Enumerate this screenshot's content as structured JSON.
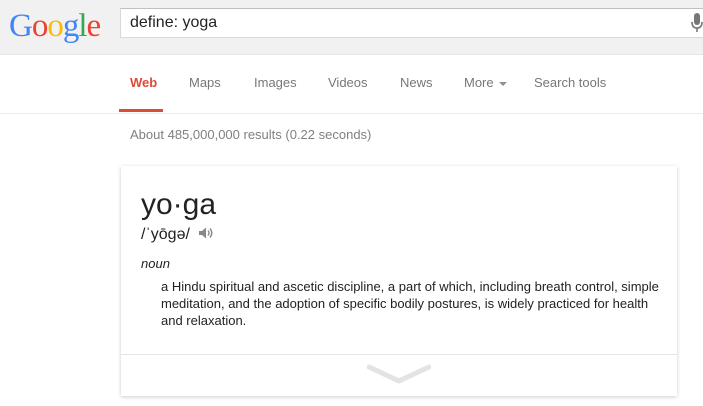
{
  "header": {
    "logo_letters": [
      {
        "ch": "G",
        "color": "#4285f4"
      },
      {
        "ch": "o",
        "color": "#ea4335"
      },
      {
        "ch": "o",
        "color": "#fbbc05"
      },
      {
        "ch": "g",
        "color": "#4285f4"
      },
      {
        "ch": "l",
        "color": "#34a853"
      },
      {
        "ch": "e",
        "color": "#ea4335"
      }
    ],
    "search_value": "define: yoga",
    "mic_icon": "microphone-icon"
  },
  "nav": {
    "tabs": [
      {
        "label": "Web",
        "active": true
      },
      {
        "label": "Maps",
        "active": false
      },
      {
        "label": "Images",
        "active": false
      },
      {
        "label": "Videos",
        "active": false
      },
      {
        "label": "News",
        "active": false
      },
      {
        "label": "More",
        "active": false
      },
      {
        "label": "Search tools",
        "active": false
      }
    ],
    "active_color": "#dd4b39"
  },
  "results": {
    "stats": "About 485,000,000 results (0.22 seconds)"
  },
  "definition_card": {
    "word": "yo·ga",
    "pronunciation": "/ˈyōgə/",
    "speaker_icon": "speaker-icon",
    "part_of_speech": "noun",
    "definition": "a Hindu spiritual and ascetic discipline, a part of which, including breath control, simple meditation, and the adoption of specific bodily postures, is widely practiced for health and relaxation.",
    "expand_icon": "chevron-down-icon"
  }
}
